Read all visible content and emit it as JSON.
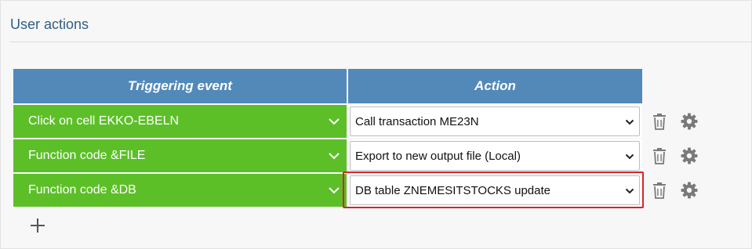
{
  "section": {
    "title": "User actions"
  },
  "table": {
    "headers": {
      "event": "Triggering event",
      "action": "Action"
    },
    "rows": [
      {
        "event": "Click on cell EKKO-EBELN",
        "action": "Call transaction ME23N"
      },
      {
        "event": "Function code &FILE",
        "action": "Export to new output file (Local)"
      },
      {
        "event": "Function code &DB",
        "action": "DB table ZNEMESITSTOCKS update"
      }
    ]
  },
  "icons": {
    "row_delete": "trash-icon",
    "row_settings": "gear-icon",
    "event_dropdown": "chevron-down-icon",
    "action_dropdown": "caret-down-icon",
    "add_row": "plus-icon"
  },
  "colors": {
    "title": "#2f5d85",
    "header_bg": "#5289b9",
    "event_bg": "#5cbf28",
    "highlight": "#d9232a",
    "icon": "#7a7a7a"
  },
  "highlighted_row": 2
}
